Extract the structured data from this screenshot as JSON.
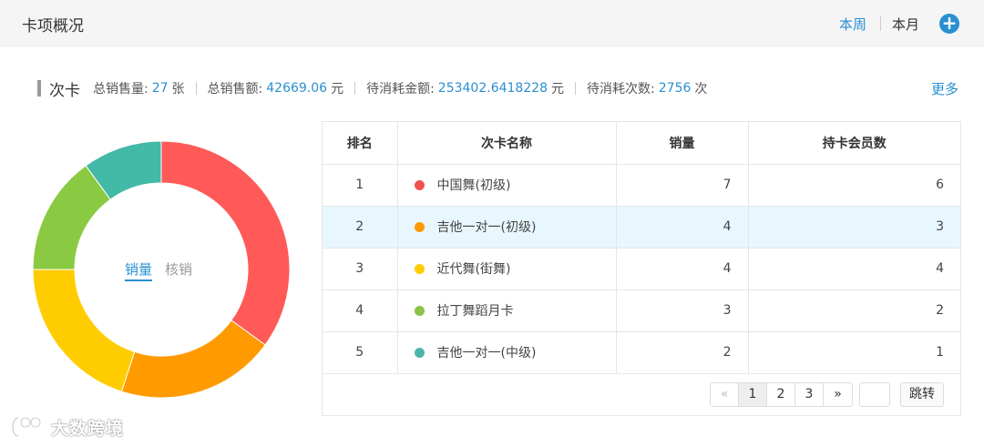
{
  "header": {
    "title": "卡项概况",
    "period_week": "本周",
    "period_month": "本月",
    "add_label": "+"
  },
  "stats": {
    "card_type": "次卡",
    "total_sales_label": "总销售量:",
    "total_sales_value": "27",
    "total_sales_unit": "张",
    "total_amount_label": "总销售额:",
    "total_amount_value": "42669.06",
    "total_amount_unit": "元",
    "pending_amount_label": "待消耗金额:",
    "pending_amount_value": "253402.6418228",
    "pending_amount_unit": "元",
    "pending_times_label": "待消耗次数:",
    "pending_times_value": "2756",
    "pending_times_unit": "次",
    "more_label": "更多"
  },
  "donut_tabs": {
    "sales": "销量",
    "verify": "核销"
  },
  "colors": {
    "accent": "#2a8fd1",
    "highlight_row": "#e8f7fd"
  },
  "chart_data": {
    "type": "pie",
    "donut": true,
    "categories": [
      "中国舞(初级)",
      "吉他一对一(初级)",
      "近代舞(街舞)",
      "拉丁舞蹈月卡",
      "吉他一对一(中级)"
    ],
    "values": [
      7,
      4,
      4,
      3,
      2
    ],
    "colors": [
      "#ff5a57",
      "#ff9a00",
      "#ffcc00",
      "#8ac942",
      "#43b9a8"
    ]
  },
  "table": {
    "headers": [
      "排名",
      "次卡名称",
      "销量",
      "持卡会员数"
    ],
    "rows": [
      {
        "rank": "1",
        "name": "中国舞(初级)",
        "color": "#ef5350",
        "sales": "7",
        "members": "6"
      },
      {
        "rank": "2",
        "name": "吉他一对一(初级)",
        "color": "#ff9800",
        "sales": "4",
        "members": "3"
      },
      {
        "rank": "3",
        "name": "近代舞(街舞)",
        "color": "#ffcc00",
        "sales": "4",
        "members": "4"
      },
      {
        "rank": "4",
        "name": "拉丁舞蹈月卡",
        "color": "#8bc34a",
        "sales": "3",
        "members": "2"
      },
      {
        "rank": "5",
        "name": "吉他一对一(中级)",
        "color": "#4db6ac",
        "sales": "2",
        "members": "1"
      }
    ]
  },
  "pagination": {
    "prev": "«",
    "pages": [
      "1",
      "2",
      "3"
    ],
    "next": "»",
    "jump_label": "跳转"
  },
  "watermark": {
    "text": "大数跨境"
  }
}
